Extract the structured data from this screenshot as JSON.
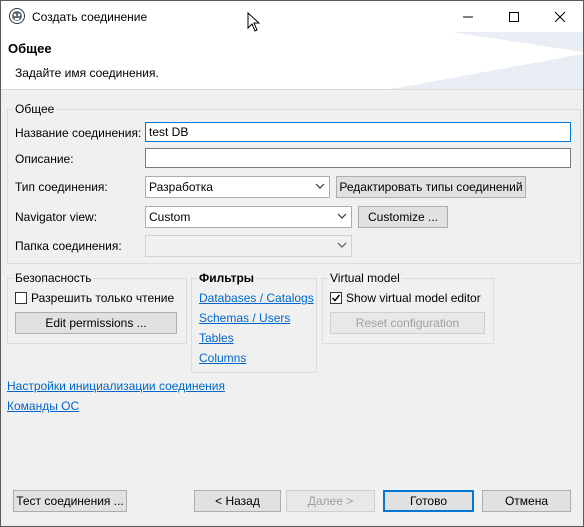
{
  "window": {
    "title": "Создать соединение"
  },
  "header": {
    "title": "Общее",
    "subtitle": "Задайте имя соединения."
  },
  "general": {
    "legend": "Общее",
    "name_label": "Название соединения:",
    "name_value": "test DB",
    "description_label": "Описание:",
    "description_value": "",
    "type_label": "Тип соединения:",
    "type_value": "Разработка",
    "edit_types_label": "Редактировать типы соединений",
    "navigator_label": "Navigator view:",
    "navigator_value": "Custom",
    "customize_label": "Customize ...",
    "folder_label": "Папка соединения:",
    "folder_value": ""
  },
  "security": {
    "legend": "Безопасность",
    "readonly_label": "Разрешить только чтение",
    "readonly_checked": false,
    "edit_permissions_label": "Edit permissions ..."
  },
  "filters": {
    "legend": "Фильтры",
    "links": [
      "Databases / Catalogs",
      "Schemas / Users",
      "Tables",
      "Columns"
    ]
  },
  "virtual_model": {
    "legend": "Virtual model",
    "show_editor_label": "Show virtual model editor",
    "show_editor_checked": true,
    "reset_label": "Reset configuration"
  },
  "links": {
    "init_settings": "Настройки инициализации соединения",
    "os_commands": "Команды ОС"
  },
  "footer": {
    "test_label": "Тест соединения ...",
    "back_label": "< Назад",
    "next_label": "Далее >",
    "finish_label": "Готово",
    "cancel_label": "Отмена"
  }
}
